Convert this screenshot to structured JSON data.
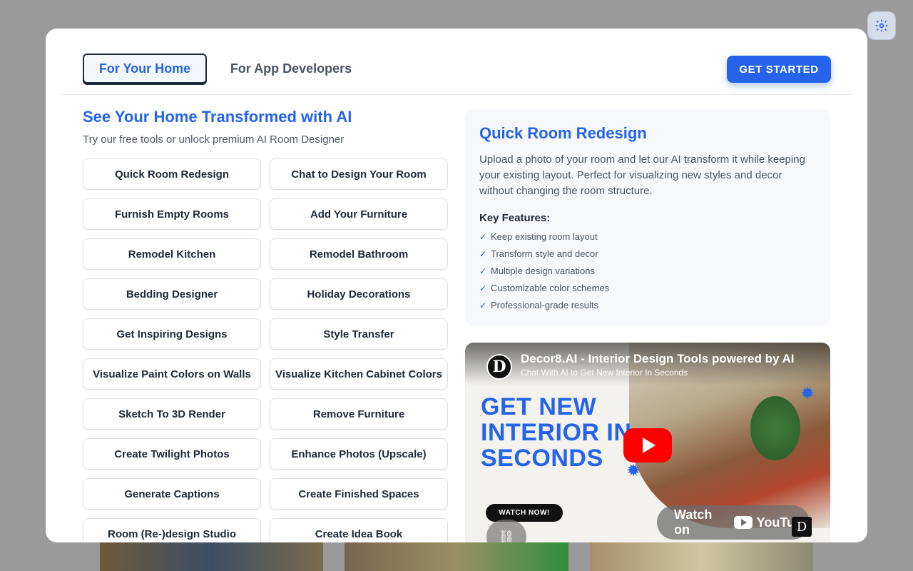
{
  "tabs": [
    {
      "label": "For Your Home",
      "active": true
    },
    {
      "label": "For App Developers",
      "active": false
    }
  ],
  "get_started_label": "GET STARTED",
  "hero": {
    "title": "See Your Home Transformed with AI",
    "subtitle": "Try our free tools or unlock premium AI Room Designer"
  },
  "tools": [
    "Quick Room Redesign",
    "Chat to Design Your Room",
    "Furnish Empty Rooms",
    "Add Your Furniture",
    "Remodel Kitchen",
    "Remodel Bathroom",
    "Bedding Designer",
    "Holiday Decorations",
    "Get Inspiring Designs",
    "Style Transfer",
    "Visualize Paint Colors on Walls",
    "Visualize Kitchen Cabinet Colors",
    "Sketch To 3D Render",
    "Remove Furniture",
    "Create Twilight Photos",
    "Enhance Photos (Upscale)",
    "Generate Captions",
    "Create Finished Spaces",
    "Room (Re-)design Studio",
    "Create Idea Book"
  ],
  "info": {
    "title": "Quick Room Redesign",
    "description": "Upload a photo of your room and let our AI transform it while keeping your existing layout. Perfect for visualizing new styles and decor without changing the room structure.",
    "features_title": "Key Features:",
    "features": [
      "Keep existing room layout",
      "Transform style and decor",
      "Multiple design variations",
      "Customizable color schemes",
      "Professional-grade results"
    ]
  },
  "video": {
    "title": "Decor8.AI - Interior Design Tools powered by AI",
    "channel_line": "Chat With AI to Get New Interior In Seconds",
    "big_text": "GET NEW INTERIOR IN SECONDS",
    "watch_now": "WATCH NOW!",
    "watch_on": "Watch on",
    "youtube": "YouTube",
    "logo_letter": "D"
  },
  "colors": {
    "accent": "#2563eb",
    "youtube_red": "#ff0000"
  }
}
